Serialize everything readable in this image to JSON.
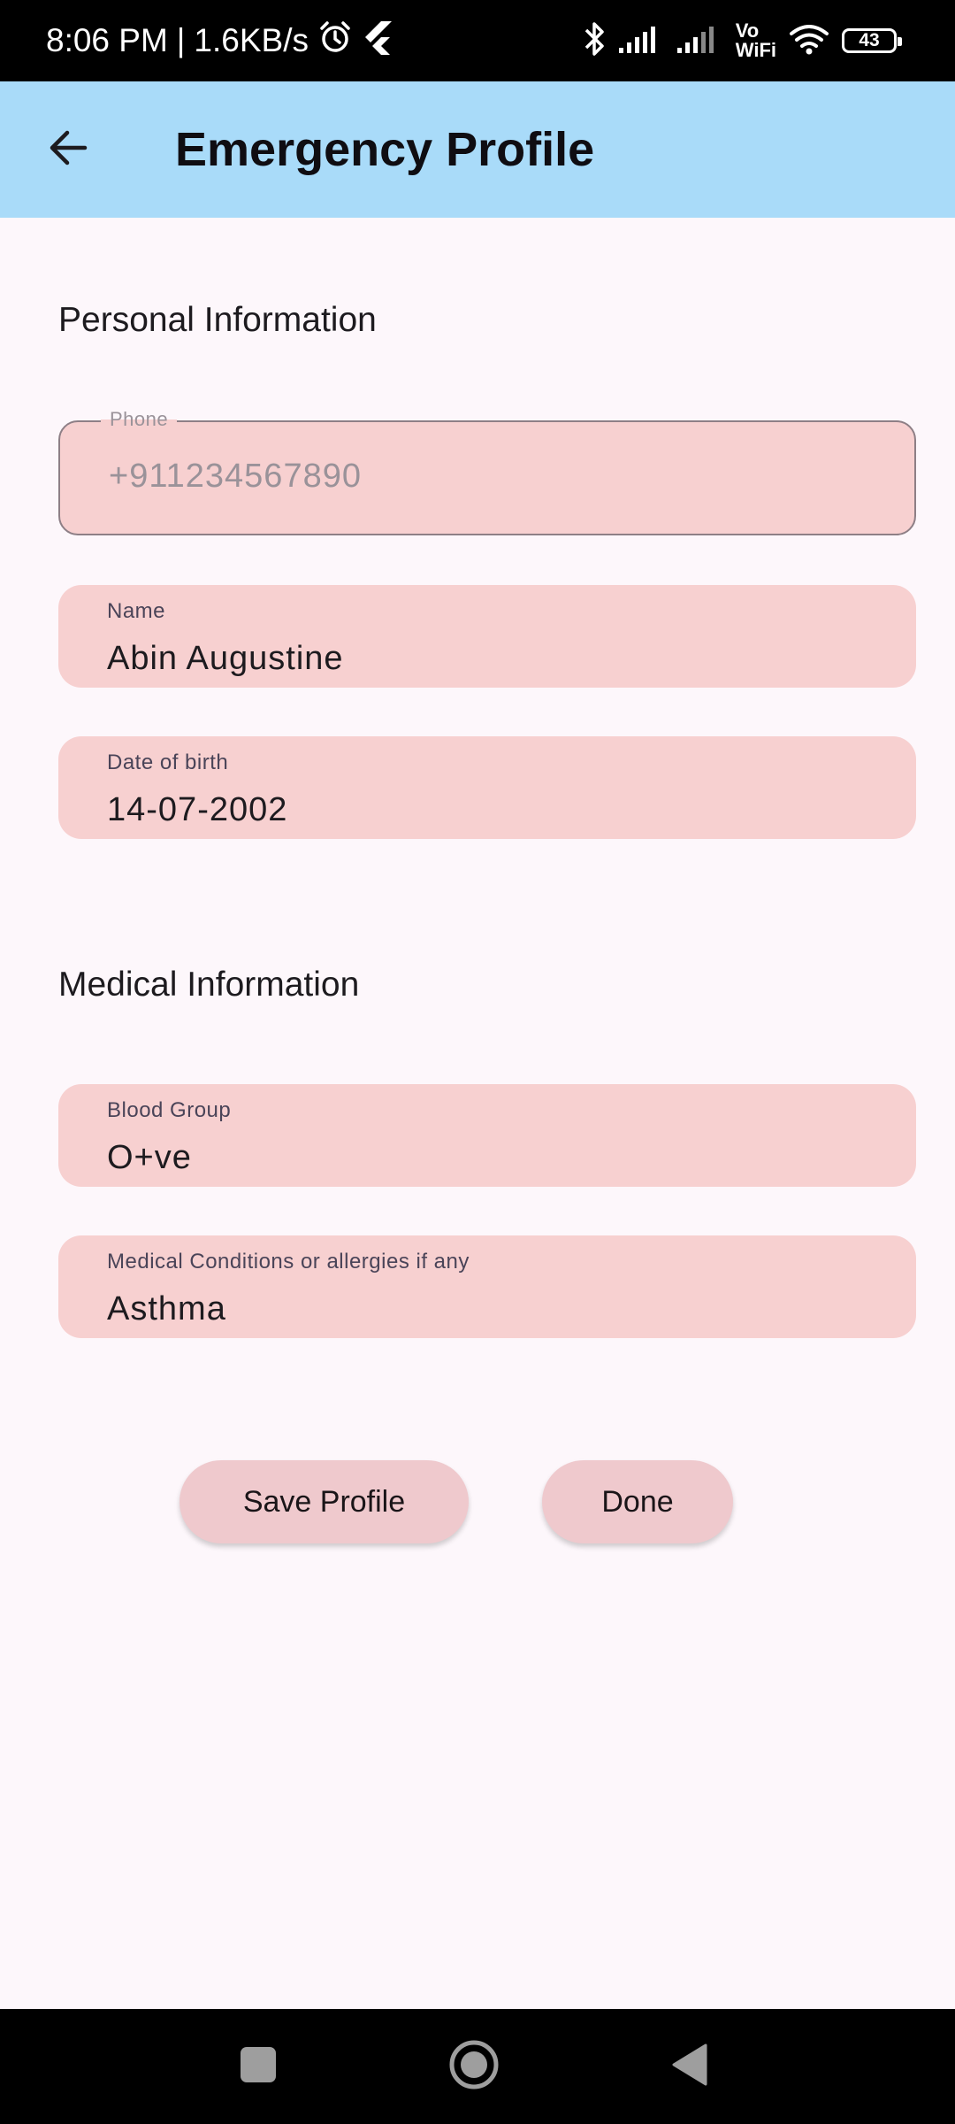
{
  "status_bar": {
    "time": "8:06 PM",
    "separator": "|",
    "speed": "1.6KB/s",
    "vowifi_top": "Vo",
    "vowifi_bottom": "WiFi",
    "battery": "43",
    "icons": [
      "alarm-icon",
      "flutter-icon",
      "bluetooth-icon",
      "signal-icon",
      "signal-icon",
      "vowifi-icon",
      "wifi-icon",
      "battery-icon"
    ]
  },
  "app_bar": {
    "title": "Emergency Profile",
    "back_icon": "arrow-back-icon",
    "background": "#a9dbf9"
  },
  "personal_section": {
    "title": "Personal Information",
    "phone": {
      "label": "Phone",
      "placeholder": "+911234567890"
    },
    "name": {
      "label": "Name",
      "value": "Abin Augustine"
    },
    "dob": {
      "label": "Date of birth",
      "value": "14-07-2002"
    }
  },
  "medical_section": {
    "title": "Medical Information",
    "blood_group": {
      "label": "Blood Group",
      "value": "O+ve"
    },
    "conditions": {
      "label": "Medical Conditions or allergies if any",
      "value": "Asthma"
    }
  },
  "actions": {
    "save_label": "Save Profile",
    "done_label": "Done"
  },
  "colors": {
    "field_fill": "#f7d0d0",
    "button_fill": "#efc9cd",
    "page_background": "#fdf7fb"
  },
  "nav_bar": {
    "icons": [
      "recents-square-icon",
      "home-circle-icon",
      "back-triangle-icon"
    ]
  }
}
